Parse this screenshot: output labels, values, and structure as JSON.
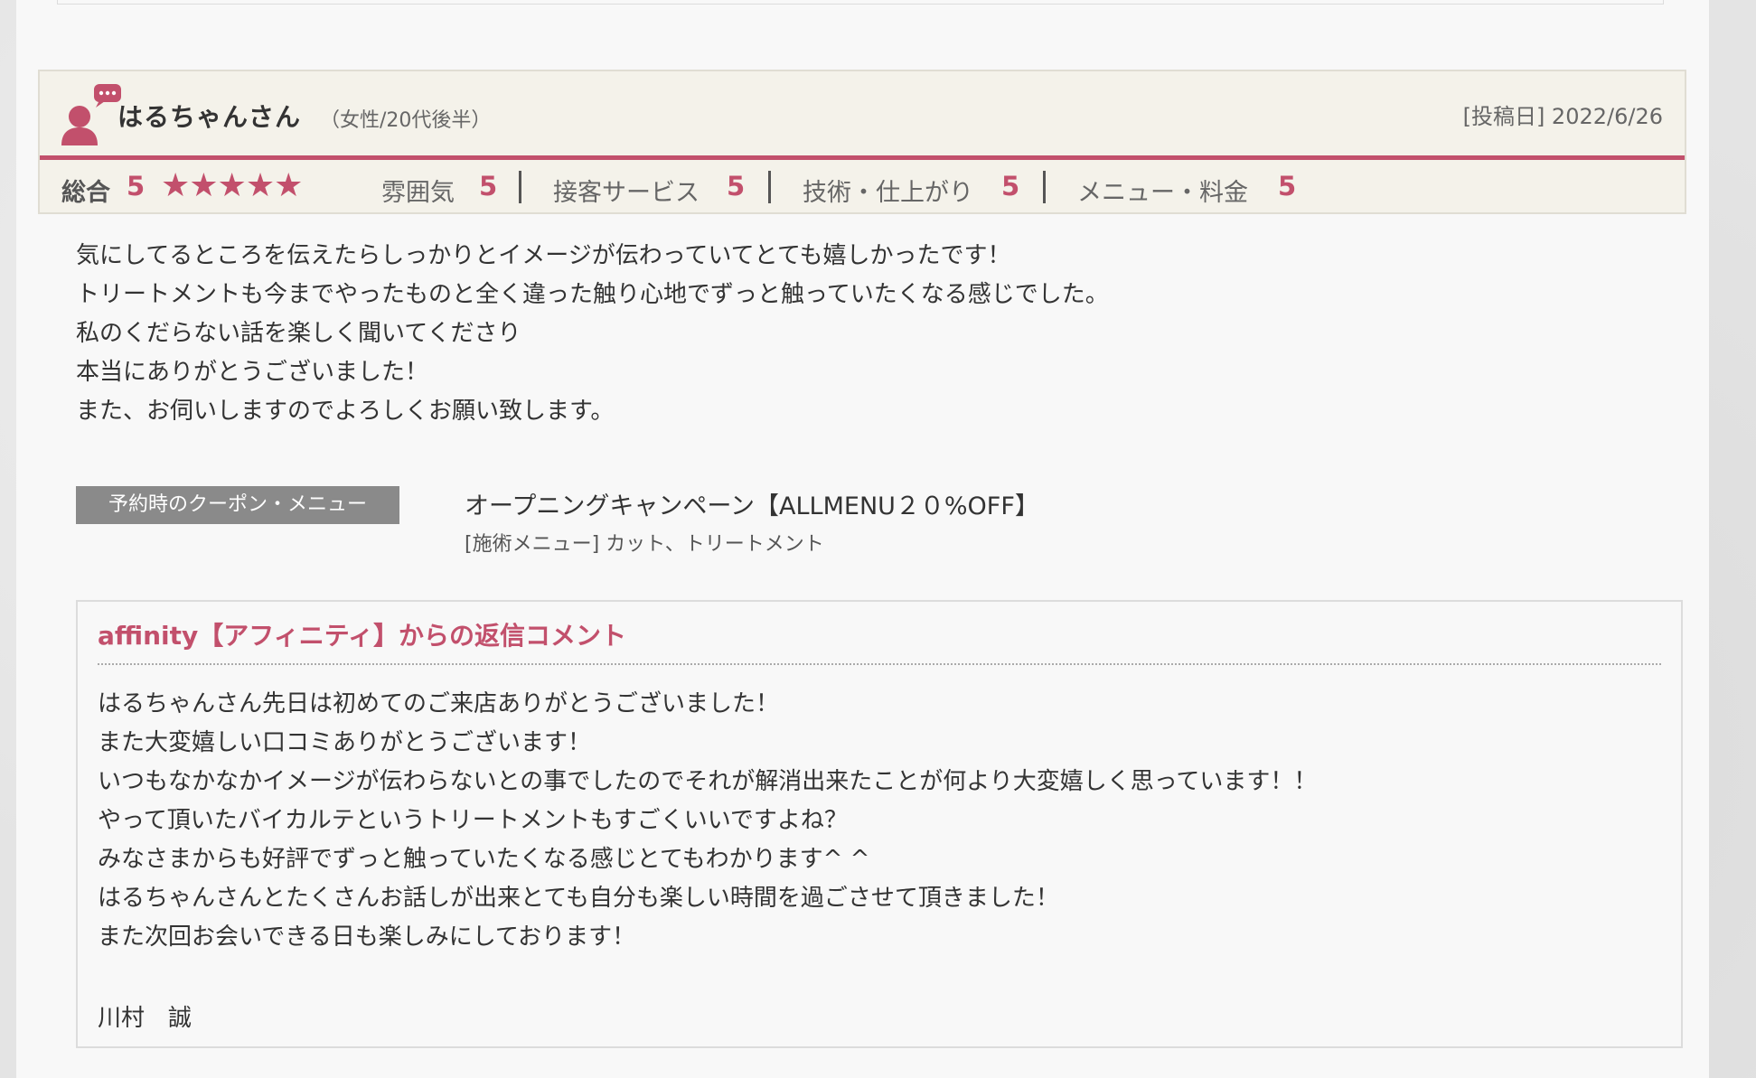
{
  "review": {
    "reviewer_name": "はるちゃんさん",
    "reviewer_meta": "（女性/20代後半）",
    "post_date": "[投稿日] 2022/6/26",
    "overall_label": "総合",
    "overall_score": "5",
    "stars": "★★★★★",
    "star_rating": 5,
    "categories": [
      {
        "label": "雰囲気",
        "score": "5"
      },
      {
        "label": "接客サービス",
        "score": "5"
      },
      {
        "label": "技術・仕上がり",
        "score": "5"
      },
      {
        "label": "メニュー・料金",
        "score": "5"
      }
    ],
    "body_lines": [
      "気にしてるところを伝えたらしっかりとイメージが伝わっていてとても嬉しかったです！",
      "トリートメントも今までやったものと全く違った触り心地でずっと触っていたくなる感じでした。",
      "私のくだらない話を楽しく聞いてくださり",
      "本当にありがとうございました！",
      "また、お伺いしますのでよろしくお願い致します。"
    ]
  },
  "coupon": {
    "badge": "予約時のクーポン・メニュー",
    "name": "オープニングキャンペーン【ALLMENU２０%OFF】",
    "menu": "[施術メニュー] カット、トリートメント"
  },
  "reply": {
    "title": "affinity【アフィニティ】からの返信コメント",
    "lines": [
      "はるちゃんさん先日は初めてのご来店ありがとうございました！",
      "また大変嬉しい口コミありがとうございます！",
      "いつもなかなかイメージが伝わらないとの事でしたのでそれが解消出来たことが何より大変嬉しく思っています！！",
      "やって頂いたバイカルテというトリートメントもすごくいいですよね？",
      "みなさまからも好評でずっと触っていたくなる感じとてもわかります^ ^",
      "はるちゃんさんとたくさんお話しが出来とても自分も楽しい時間を過ごさせて頂きました！",
      "また次回お会いできる日も楽しみにしております！"
    ],
    "signature": "川村　誠"
  },
  "colors": {
    "accent": "#c2506c",
    "header_bg": "#f4f2ea",
    "badge_bg": "#8a8a8a"
  },
  "icons": {
    "reviewer": "user-speech-bubble-icon"
  }
}
